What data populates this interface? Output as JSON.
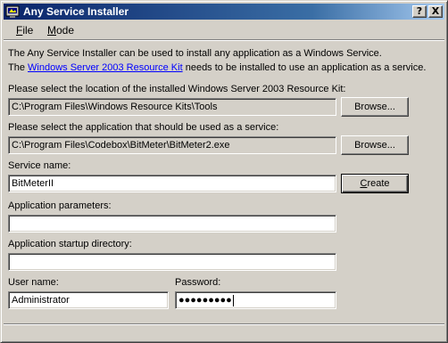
{
  "window": {
    "title": "Any Service Installer",
    "help_button": "?",
    "close_button": "X"
  },
  "menu": {
    "file_accel": "F",
    "file_rest": "ile",
    "mode_accel": "M",
    "mode_rest": "ode"
  },
  "intro": {
    "line1": "The Any Service Installer can be used to install any application as a Windows Service.",
    "line2_prefix": "The ",
    "line2_link": "Windows Server 2003 Resource Kit",
    "line2_suffix": " needs to be installed to use an application as a service."
  },
  "resource_kit": {
    "label": "Please select the location of the installed Windows Server 2003 Resource Kit:",
    "value": "C:\\Program Files\\Windows Resource Kits\\Tools",
    "browse_label": "Browse..."
  },
  "application": {
    "label": "Please select the application that should be used as a service:",
    "value": "C:\\Program Files\\Codebox\\BitMeter\\BitMeter2.exe",
    "browse_label": "Browse..."
  },
  "service_name": {
    "label": "Service name:",
    "value": "BitMeterII",
    "create_accel": "C",
    "create_rest": "reate"
  },
  "app_params": {
    "label": "Application parameters:",
    "value": ""
  },
  "startup_dir": {
    "label": "Application startup directory:",
    "value": ""
  },
  "credentials": {
    "user_label": "User name:",
    "user_value": "Administrator",
    "password_label": "Password:",
    "password_value": "●●●●●●●●●"
  },
  "colors": {
    "title_gradient_start": "#0a246a",
    "title_gradient_end": "#a6caf0",
    "face": "#d4d0c8",
    "link": "#0000ff"
  },
  "icons": {
    "app": "app-icon"
  }
}
